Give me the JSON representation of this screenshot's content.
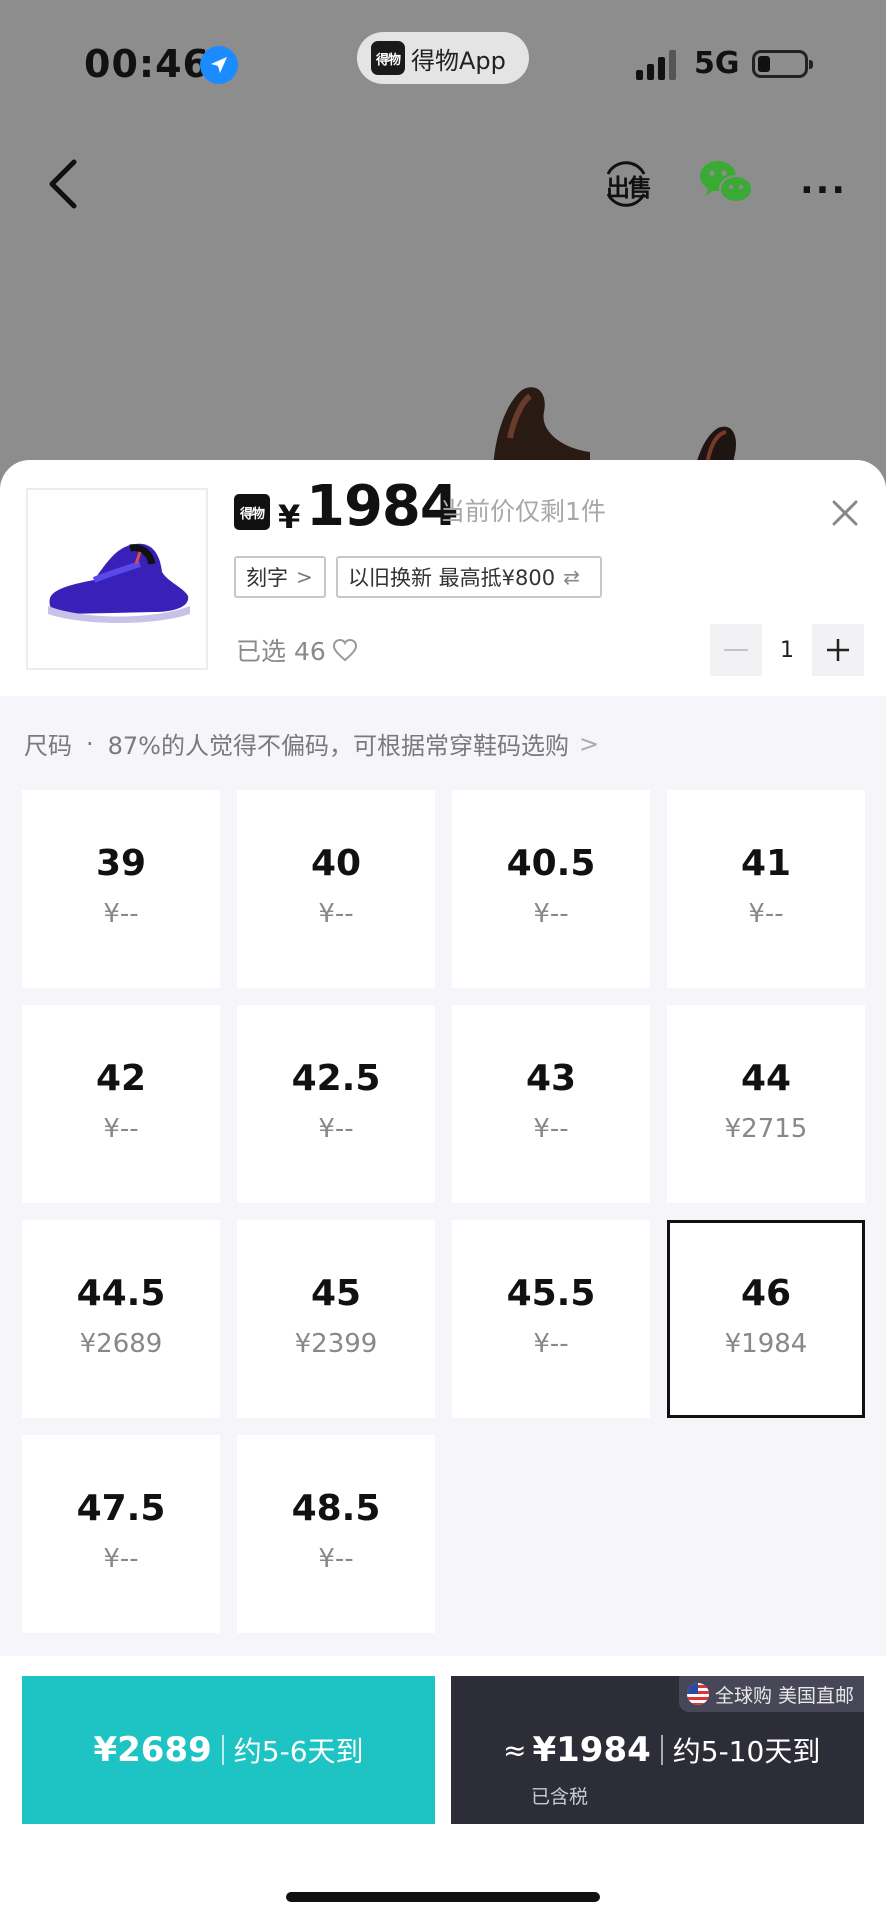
{
  "status_bar": {
    "time": "00:46",
    "app_pill_logo": "得物",
    "app_pill_text": "得物App",
    "network": "5G"
  },
  "nav": {
    "sell_label": "出售",
    "more_label": "···"
  },
  "product": {
    "brand_logo": "得物",
    "currency": "¥",
    "price": "1984",
    "stock_note": "当前价仅剩1件",
    "tags": {
      "engrave": "刻字",
      "trade_in": "以旧换新 最高抵¥800"
    },
    "selected_label": "已选 46",
    "quantity": "1"
  },
  "size_section": {
    "label": "尺码",
    "hint": "87%的人觉得不偏码，可根据常穿鞋码选购",
    "sizes": [
      {
        "size": "39",
        "price": "¥--"
      },
      {
        "size": "40",
        "price": "¥--"
      },
      {
        "size": "40.5",
        "price": "¥--"
      },
      {
        "size": "41",
        "price": "¥--"
      },
      {
        "size": "42",
        "price": "¥--"
      },
      {
        "size": "42.5",
        "price": "¥--"
      },
      {
        "size": "43",
        "price": "¥--"
      },
      {
        "size": "44",
        "price": "¥2715"
      },
      {
        "size": "44.5",
        "price": "¥2689"
      },
      {
        "size": "45",
        "price": "¥2399"
      },
      {
        "size": "45.5",
        "price": "¥--"
      },
      {
        "size": "46",
        "price": "¥1984"
      },
      {
        "size": "47.5",
        "price": "¥--"
      },
      {
        "size": "48.5",
        "price": "¥--"
      }
    ],
    "selected_size": "46"
  },
  "bottom": {
    "fast": {
      "price": "¥2689",
      "eta": "约5-6天到"
    },
    "global": {
      "badge": "全球购 美国直邮",
      "approx": "≈",
      "price": "¥1984",
      "eta": "约5-10天到",
      "tax_note": "已含税"
    }
  },
  "icons": [
    "location-arrow-icon",
    "back-chevron-icon",
    "wechat-icon",
    "close-icon",
    "heart-icon",
    "minus-icon",
    "plus-icon",
    "us-flag-icon"
  ],
  "colors": {
    "accent_teal": "#1ec3c3",
    "dark_button": "#2d2d38",
    "location_blue": "#1a8cff",
    "wechat_green": "#3aaa35"
  }
}
